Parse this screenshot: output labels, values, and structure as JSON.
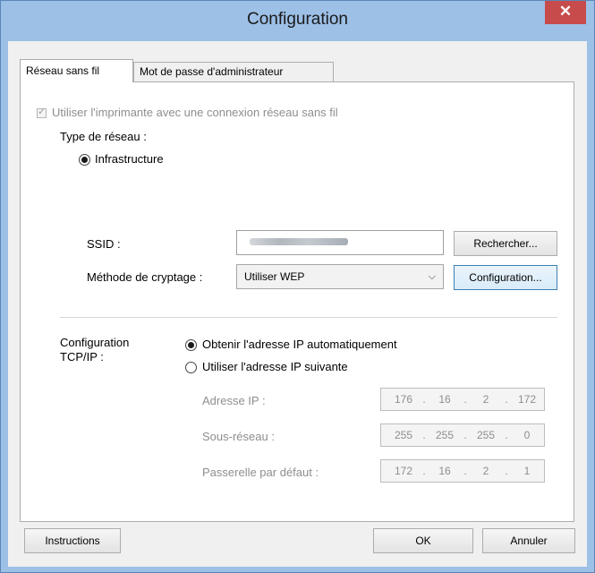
{
  "window": {
    "title": "Configuration",
    "close_glyph": "✕"
  },
  "tabs": [
    {
      "label": "Réseau sans fil",
      "active": true
    },
    {
      "label": "Mot de passe d'administrateur",
      "active": false
    }
  ],
  "wireless": {
    "use_wireless": {
      "label": "Utiliser l'imprimante avec une connexion réseau sans fil",
      "checked": true,
      "enabled": false
    },
    "network_type_label": "Type de réseau :",
    "infrastructure_label": "Infrastructure",
    "ssid_label": "SSID :",
    "search_button": "Rechercher...",
    "encryption_label": "Méthode de cryptage :",
    "encryption_value": "Utiliser WEP",
    "config_button": "Configuration..."
  },
  "tcpip": {
    "label_line1": "Configuration",
    "label_line2": "TCP/IP :",
    "auto_ip_label": "Obtenir l'adresse IP automatiquement",
    "manual_ip_label": "Utiliser l'adresse IP suivante",
    "selected": "auto",
    "ip_label": "Adresse IP :",
    "ip": [
      "176",
      "16",
      "2",
      "172"
    ],
    "subnet_label": "Sous-réseau :",
    "subnet": [
      "255",
      "255",
      "255",
      "0"
    ],
    "gateway_label": "Passerelle par défaut :",
    "gateway": [
      "172",
      "16",
      "2",
      "1"
    ]
  },
  "footer": {
    "instructions_button": "Instructions",
    "ok_button": "OK",
    "cancel_button": "Annuler"
  },
  "colors": {
    "title_bar": "#9dc0e6",
    "close_button": "#c74b4b",
    "focus_border": "#3c7fb1"
  }
}
